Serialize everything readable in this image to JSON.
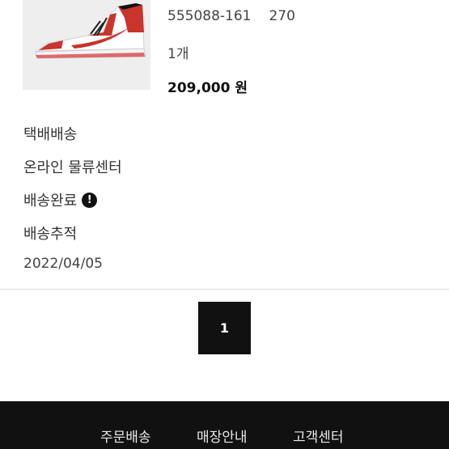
{
  "product": {
    "style_code": "555088-161",
    "size": "270",
    "quantity": "1개",
    "price": "209,000 원",
    "image_icon": "sneaker-image"
  },
  "delivery": {
    "method": "택배배송",
    "center": "온라인 물류센터",
    "status": "배송완료",
    "status_icon": "exclamation-icon",
    "tracking_label": "배송추적",
    "date": "2022/04/05"
  },
  "pagination": {
    "current_page": "1"
  },
  "footer": {
    "links": [
      "주문배송",
      "매장안내",
      "고객센터"
    ]
  },
  "colors": {
    "footer_bg": "#111111",
    "page_button_bg": "#111111",
    "sneaker_red": "#c9342c"
  }
}
